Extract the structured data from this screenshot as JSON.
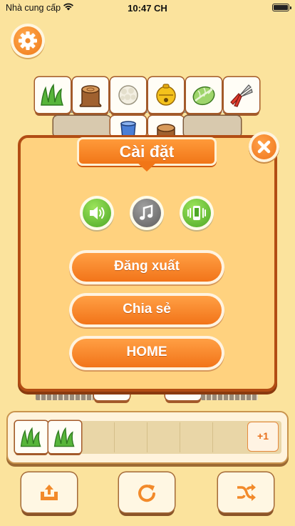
{
  "status_bar": {
    "carrier": "Nhà cung cấp",
    "time": "10:47 CH"
  },
  "settings_dialog": {
    "title": "Cài đặt",
    "toggles": [
      {
        "icon": "speaker-icon",
        "state": "on",
        "color": "#4da826"
      },
      {
        "icon": "music-note-icon",
        "state": "off",
        "color": "#5e5e5e"
      },
      {
        "icon": "vibrate-icon",
        "state": "on",
        "color": "#4da826"
      }
    ],
    "buttons": {
      "logout": "Đăng xuất",
      "share": "Chia sẻ",
      "home": "HOME"
    }
  },
  "board": {
    "top_row": [
      "grass-tile-icon",
      "tree-stump-tile-icon",
      "cauliflower-tile-icon",
      "bell-tile-icon",
      "cabbage-tile-icon",
      "pruning-shears-tile-icon"
    ],
    "second_row_visible": [
      "bucket-tile-icon",
      "tree-stump-tile-icon"
    ]
  },
  "tray": {
    "tiles": [
      "grass-tile-icon",
      "grass-tile-icon"
    ],
    "slot_count": 7,
    "extra_slot_label": "+1"
  },
  "toolbar": [
    "undo-out-icon",
    "refresh-icon",
    "shuffle-icon"
  ],
  "colors": {
    "background": "#fbe39d",
    "accent_orange": "#f27419",
    "panel": "#ffd27f",
    "border": "#b24d14"
  }
}
